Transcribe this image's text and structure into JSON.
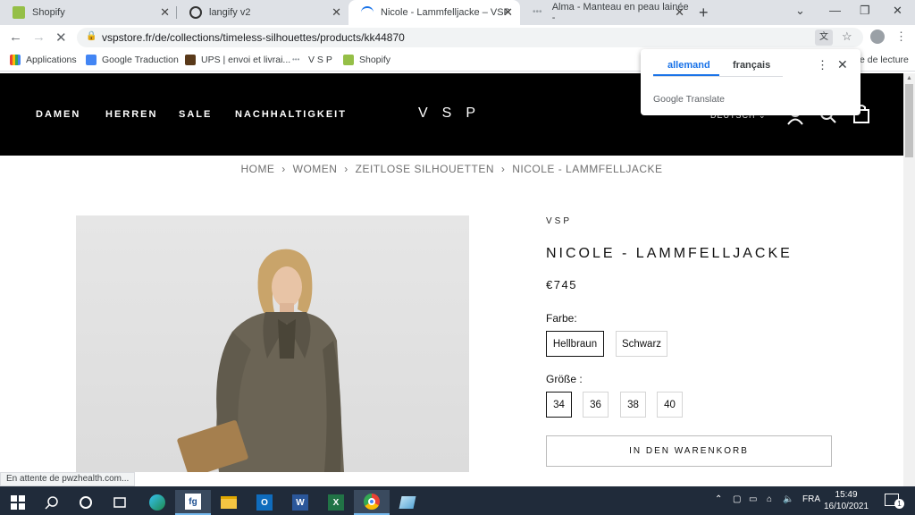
{
  "tabs": [
    {
      "label": "Shopify",
      "favicon_color": "#95bf47"
    },
    {
      "label": "langify v2",
      "favicon_color": "#333333"
    },
    {
      "label": "Nicole - Lammfelljacke – VSP",
      "favicon_color": "#1a73e8"
    },
    {
      "label": "Alma - Manteau en peau lainée -",
      "favicon_color": "#9aa0a6"
    }
  ],
  "toolbar": {
    "url": "vspstore.fr/de/collections/timeless-silhouettes/products/kk44870"
  },
  "bookmarks": [
    {
      "label": "Applications"
    },
    {
      "label": "Google Traduction"
    },
    {
      "label": "UPS | envoi et livrai..."
    },
    {
      "label": "V S P"
    },
    {
      "label": "Shopify"
    }
  ],
  "translate": {
    "source_lang": "allemand",
    "target_lang": "français",
    "brand": "Google Translate"
  },
  "reading_mode_partial": "e de lecture",
  "site": {
    "nav": [
      "DAMEN",
      "HERREN",
      "SALE",
      "NACHHALTIGKEIT"
    ],
    "logo": "VSP",
    "language": "DEUTSCH"
  },
  "breadcrumb": [
    "HOME",
    "WOMEN",
    "ZEITLOSE SILHOUETTEN",
    "NICOLE - LAMMFELLJACKE"
  ],
  "product": {
    "brand": "VSP",
    "title": "NICOLE - LAMMFELLJACKE",
    "price": "€745",
    "color_label": "Farbe:",
    "colors": [
      "Hellbraun",
      "Schwarz"
    ],
    "selected_color": "Hellbraun",
    "size_label": "Größe :",
    "sizes": [
      "34",
      "36",
      "38",
      "40"
    ],
    "selected_size": "34",
    "add_to_cart": "IN DEN WARENKORB"
  },
  "status_text": "En attente de pwzhealth.com...",
  "taskbar": {
    "language": "FRA",
    "time": "15:49",
    "date": "16/10/2021",
    "notification_count": "1"
  }
}
